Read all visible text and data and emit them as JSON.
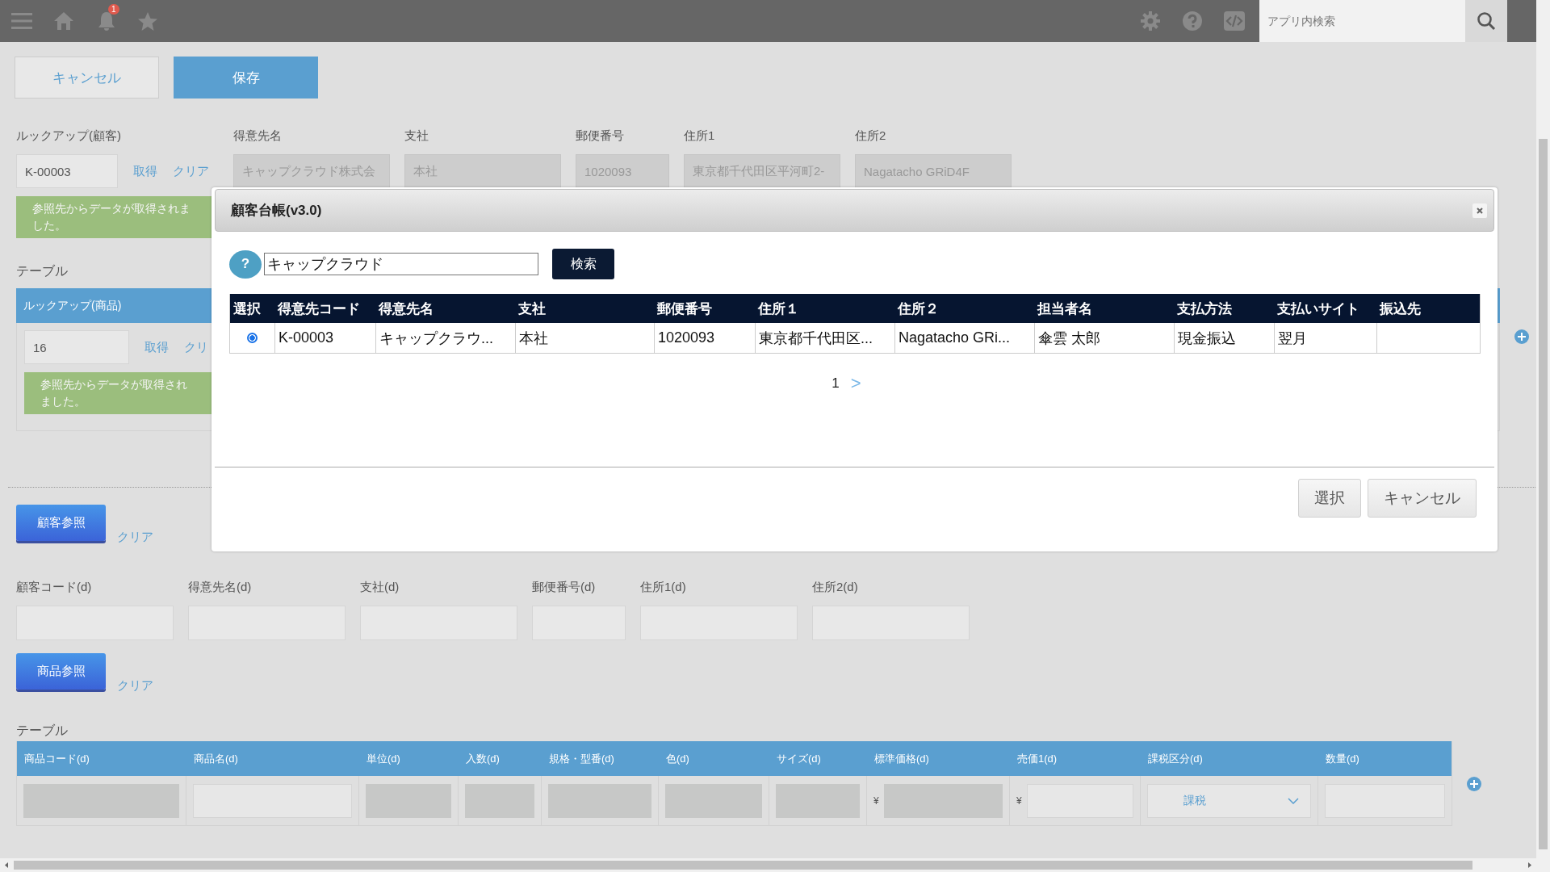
{
  "topbar": {
    "notification_count": "1",
    "search": {
      "placeholder": "アプリ内検索"
    }
  },
  "actions": [
    {
      "label": "キャンセル",
      "kind": "secondary"
    },
    {
      "label": "保存",
      "kind": "primary"
    }
  ],
  "customer_lookup": {
    "label": "ルックアップ(顧客)",
    "value": "K-00003",
    "links": [
      "取得",
      "クリア"
    ],
    "message": "参照先からデータが取得されました。",
    "fields": [
      {
        "label": "得意先名",
        "value": "キャップクラウド株式会"
      },
      {
        "label": "支社",
        "value": "本社"
      },
      {
        "label": "郵便番号",
        "value": "1020093"
      },
      {
        "label": "住所1",
        "value": "東京都千代田区平河町2-"
      },
      {
        "label": "住所2",
        "value": "Nagatacho GRiD4F"
      }
    ]
  },
  "lookup_table": {
    "label": "テーブル",
    "header": "ルックアップ(商品)",
    "value": "16",
    "links": [
      "取得",
      "クリ"
    ],
    "message": "参照先からデータが取得されました。"
  },
  "customer_ref": {
    "button": "顧客参照",
    "link": "クリア",
    "fields": [
      {
        "label": "顧客コード(d)"
      },
      {
        "label": "得意先名(d)"
      },
      {
        "label": "支社(d)"
      },
      {
        "label": "郵便番号(d)"
      },
      {
        "label": "住所1(d)"
      },
      {
        "label": "住所2(d)"
      }
    ]
  },
  "product_ref": {
    "button": "商品参照",
    "link": "クリア"
  },
  "product_table": {
    "label": "テーブル",
    "columns": [
      {
        "label": "商品コード(d)",
        "kind": "readonly"
      },
      {
        "label": "商品名(d)",
        "kind": "input"
      },
      {
        "label": "単位(d)",
        "kind": "readonly"
      },
      {
        "label": "入数(d)",
        "kind": "readonly"
      },
      {
        "label": "規格・型番(d)",
        "kind": "readonly"
      },
      {
        "label": "色(d)",
        "kind": "readonly"
      },
      {
        "label": "サイズ(d)",
        "kind": "readonly"
      },
      {
        "label": "標準価格(d)",
        "kind": "readonly",
        "currency": "¥"
      },
      {
        "label": "売価1(d)",
        "kind": "input",
        "currency": "¥"
      },
      {
        "label": "課税区分(d)",
        "kind": "select",
        "value": "課税"
      },
      {
        "label": "数量(d)",
        "kind": "input"
      }
    ]
  },
  "modal": {
    "title": "顧客台帳(v3.0)",
    "help": "?",
    "search_value": "キャップクラウド",
    "search_button": "検索",
    "columns": [
      "選択",
      "得意先コード",
      "得意先名",
      "支社",
      "郵便番号",
      "住所１",
      "住所２",
      "担当者名",
      "支払方法",
      "支払いサイト",
      "振込先"
    ],
    "rows": [
      {
        "selected": true,
        "cells": [
          "",
          "K-00003",
          "キャップクラウ...",
          "本社",
          "1020093",
          "東京都千代田区...",
          "Nagatacho GRi...",
          "傘雲 太郎",
          "現金振込",
          "翌月",
          ""
        ]
      }
    ],
    "pages": [
      "1"
    ],
    "next": ">",
    "buttons": [
      "選択",
      "キャンセル"
    ]
  }
}
